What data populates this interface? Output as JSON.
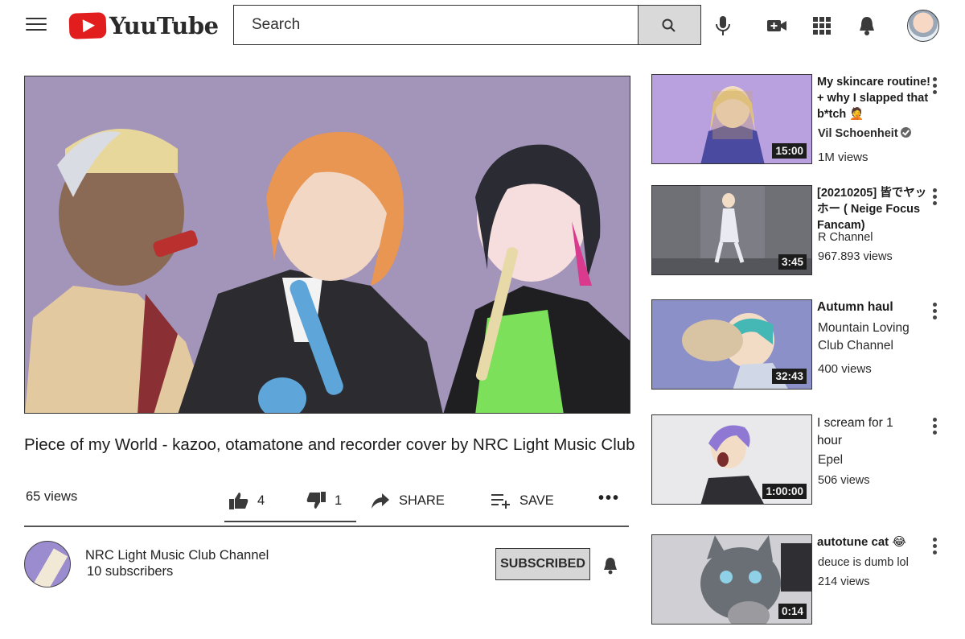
{
  "header": {
    "logo_text": "YuuTube",
    "search_placeholder": "Search"
  },
  "video": {
    "title": "Piece of my World - kazoo, otamatone and recorder cover by NRC Light Music Club",
    "views": "65 views",
    "likes": "4",
    "dislikes": "1",
    "share_label": "SHARE",
    "save_label": "SAVE",
    "more_label": "•••"
  },
  "channel": {
    "name": "NRC Light Music Club Channel",
    "subscribers": "10 subscribers",
    "subscribe_label": "SUBSCRIBED"
  },
  "recommendations": [
    {
      "title": "My skincare routine! + why I slapped that b*tch 🤦",
      "channel": "Vil Schoenheit",
      "verified": true,
      "views": "1M views",
      "duration": "15:00"
    },
    {
      "title": "[20210205] 皆でヤッホー ( Neige Focus Fancam)",
      "channel": "R Channel",
      "views": "967.893 views",
      "duration": "3:45"
    },
    {
      "title": "Autumn haul",
      "channel": "Mountain Loving Club Channel",
      "views": "400 views",
      "duration": "32:43"
    },
    {
      "title": "I scream for 1 hour",
      "channel": "Epel",
      "views": "506 views",
      "duration": "1:00:00"
    },
    {
      "title": "autotune cat 😂",
      "channel": "deuce is dumb lol",
      "views": "214 views",
      "duration": "0:14"
    }
  ],
  "colors": {
    "logo_red": "#e11d1d",
    "player_bg": "#9b8bb3",
    "subscribed_bg": "#d6d6d6"
  }
}
